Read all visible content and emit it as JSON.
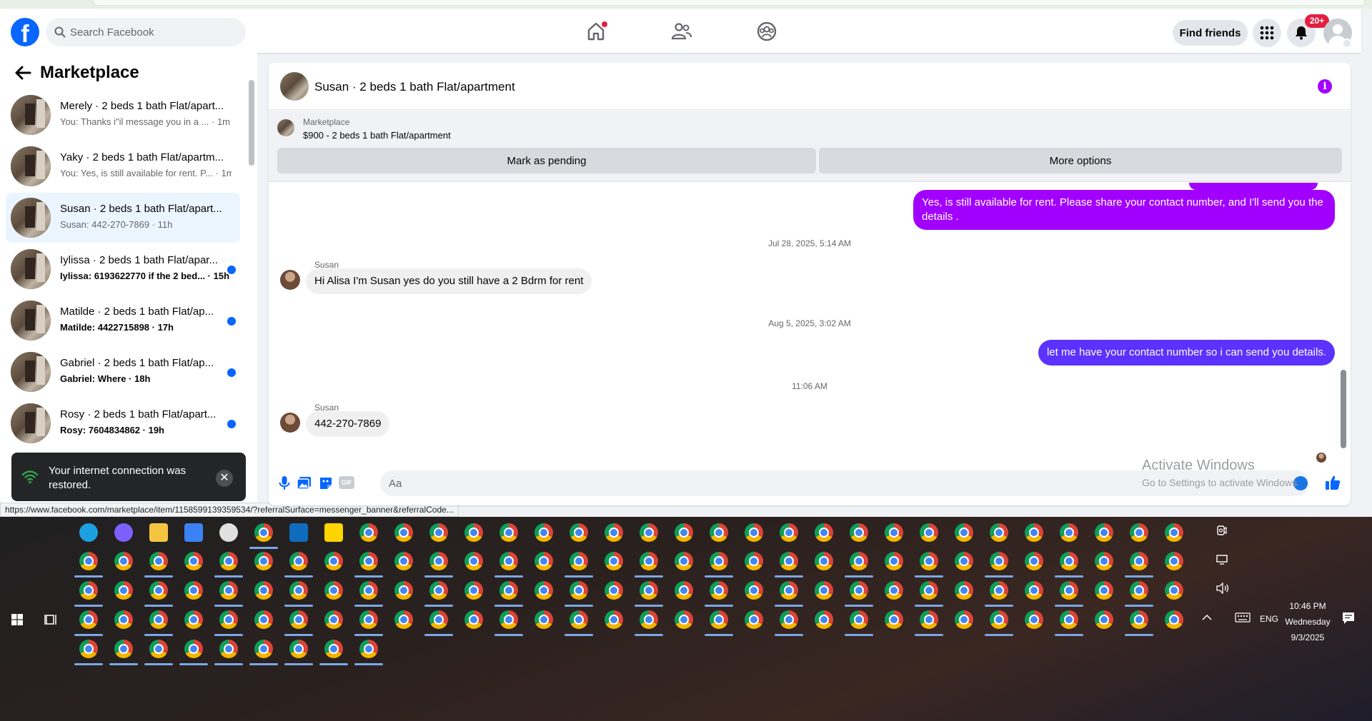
{
  "header": {
    "logo": "f",
    "search_placeholder": "Search Facebook",
    "find_friends": "Find friends",
    "notifications_badge": "20+"
  },
  "sidebar": {
    "title": "Marketplace",
    "conversations": [
      {
        "title": "Merely · 2 beds 1 bath Flat/apart...",
        "preview": "You: Thanks i\"il message you in a ... · 1m",
        "unread": false
      },
      {
        "title": "Yaky · 2 beds 1 bath Flat/apartm...",
        "preview": "You: Yes, is still available for rent. P... · 1m",
        "unread": false
      },
      {
        "title": "Susan · 2 beds 1 bath Flat/apart...",
        "preview": "Susan: 442-270-7869 · 11h",
        "unread": false,
        "active": true
      },
      {
        "title": "Iylissa · 2 beds 1 bath Flat/apar...",
        "preview": "Iylissa: 6193622770 if the 2 bed... · 15h",
        "unread": true
      },
      {
        "title": "Matilde · 2 beds 1 bath Flat/ap...",
        "preview": "Matilde: 4422715898 · 17h",
        "unread": true
      },
      {
        "title": "Gabriel · 2 beds 1 bath Flat/ap...",
        "preview": "Gabriel: Where · 18h",
        "unread": true
      },
      {
        "title": "Rosy · 2 beds 1 bath Flat/apart...",
        "preview": "Rosy: 7604834862 · 19h",
        "unread": true
      }
    ]
  },
  "toast": {
    "message": "Your internet connection was restored.",
    "close": "✕"
  },
  "status_url": "https://www.facebook.com/marketplace/item/1158599139359534/?referralSurface=messenger_banner&referralCode...",
  "chat": {
    "header_name": "Susan · 2 beds 1 bath Flat/apartment",
    "info": "i",
    "listing_source": "Marketplace",
    "listing_title": "$900 - 2 beds 1 bath Flat/apartment",
    "mark_pending": "Mark as pending",
    "more_options": "More options",
    "messages": {
      "out1": "Yes, is still available for rent. Please share your contact number, and I'll send you the details .",
      "ts1": "Jul 28, 2025, 5:14 AM",
      "sender1": "Susan",
      "in1": "Hi Alisa I'm Susan yes do you still have a 2 Bdrm for rent",
      "ts2": "Aug 5, 2025, 3:02 AM",
      "out2": "let me have your contact number so i can send you details.",
      "ts3": "11:06 AM",
      "sender2": "Susan",
      "in2": "442-270-7869"
    },
    "composer_placeholder": "Aa",
    "gif": "GIF"
  },
  "watermark": {
    "line1": "Activate Windows",
    "line2": "Go to Settings to activate Windows."
  },
  "taskbar": {
    "lang": "ENG",
    "time": "10:46 PM",
    "day": "Wednesday",
    "date": "9/3/2025"
  }
}
